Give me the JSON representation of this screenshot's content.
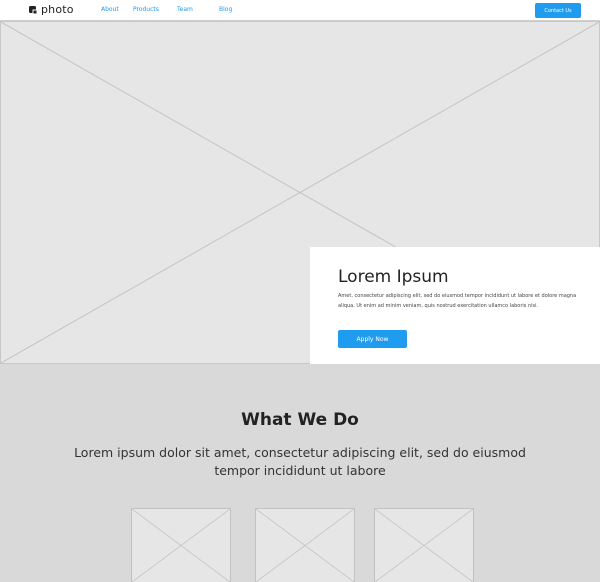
{
  "header": {
    "logo_text": "photo",
    "logo_icon": "logo-mark-icon",
    "nav": [
      {
        "label": "About"
      },
      {
        "label": "Products"
      },
      {
        "label": "Team"
      },
      {
        "label": "Blog"
      }
    ],
    "contact_label": "Contact Us"
  },
  "hero": {
    "image_icon": "image-placeholder-icon",
    "title": "Lorem Ipsum",
    "text": "Amet, consectetur adipiscing elit, sed do eiusmod tempor incididunt ut labore et dolore magna aliqua. Ut enim ad minim veniam, quis nostrud exercitation ullamco laboris nisi.",
    "button_label": "Apply Now"
  },
  "what_we_do": {
    "title": "What We Do",
    "text": "Lorem ipsum dolor sit amet, consectetur adipiscing elit, sed do eiusmod tempor incididunt ut labore"
  },
  "colors": {
    "accent": "#1f9bf0",
    "section_background": "#d9d9d9",
    "placeholder": "#e6e6e6"
  }
}
